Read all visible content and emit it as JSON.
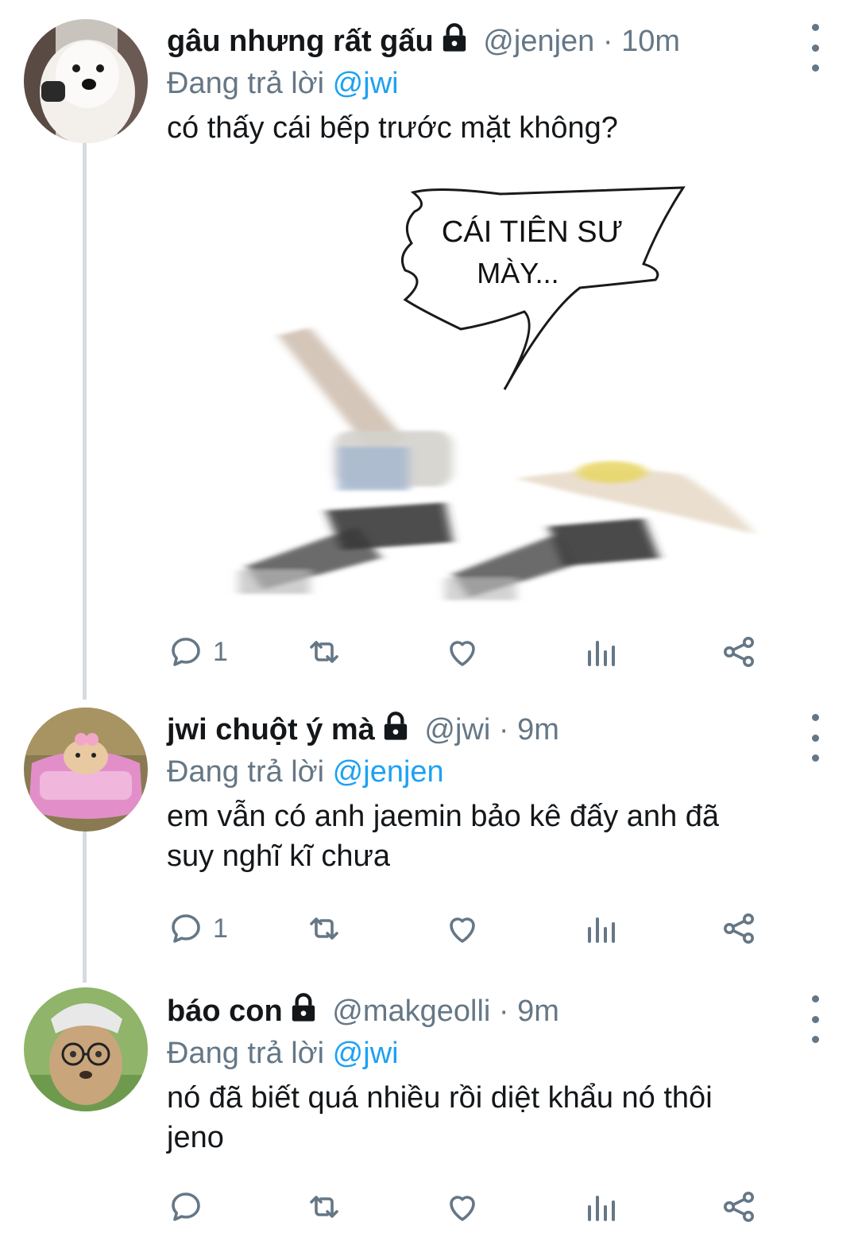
{
  "colors": {
    "accent": "#1da1f2",
    "secondary": "#657786",
    "text": "#14171a",
    "line": "#d6dbdf"
  },
  "tweets": [
    {
      "name": "gâu nhưng rất gấu",
      "handle": "@jenjen",
      "separator": "·",
      "time": "10m",
      "reply_prefix": "Đang trả lời",
      "reply_to": "@jwi",
      "text": "có thấy cái bếp trước mặt không?",
      "media": {
        "bubble_line1": "CÁI TIÊN SƯ",
        "bubble_line2": "MÀY..."
      },
      "reply_count": "1",
      "icons": [
        "lock-icon",
        "reply-icon",
        "retweet-icon",
        "like-icon",
        "analytics-icon",
        "share-icon",
        "more-icon"
      ]
    },
    {
      "name": "jwi chuột ý mà",
      "handle": "@jwi",
      "separator": "·",
      "time": "9m",
      "reply_prefix": "Đang trả lời",
      "reply_to": "@jenjen",
      "text_line1": "em vẫn có anh jaemin bảo kê đấy anh đã",
      "text_line2": "suy nghĩ kĩ chưa",
      "reply_count": "1"
    },
    {
      "name": "báo con",
      "handle": "@makgeolli",
      "separator": "·",
      "time": "9m",
      "reply_prefix": "Đang trả lời",
      "reply_to": "@jwi",
      "text_line1": "nó đã biết quá nhiều rồi diệt khẩu nó thôi",
      "text_line2": "jeno",
      "reply_count": ""
    }
  ]
}
